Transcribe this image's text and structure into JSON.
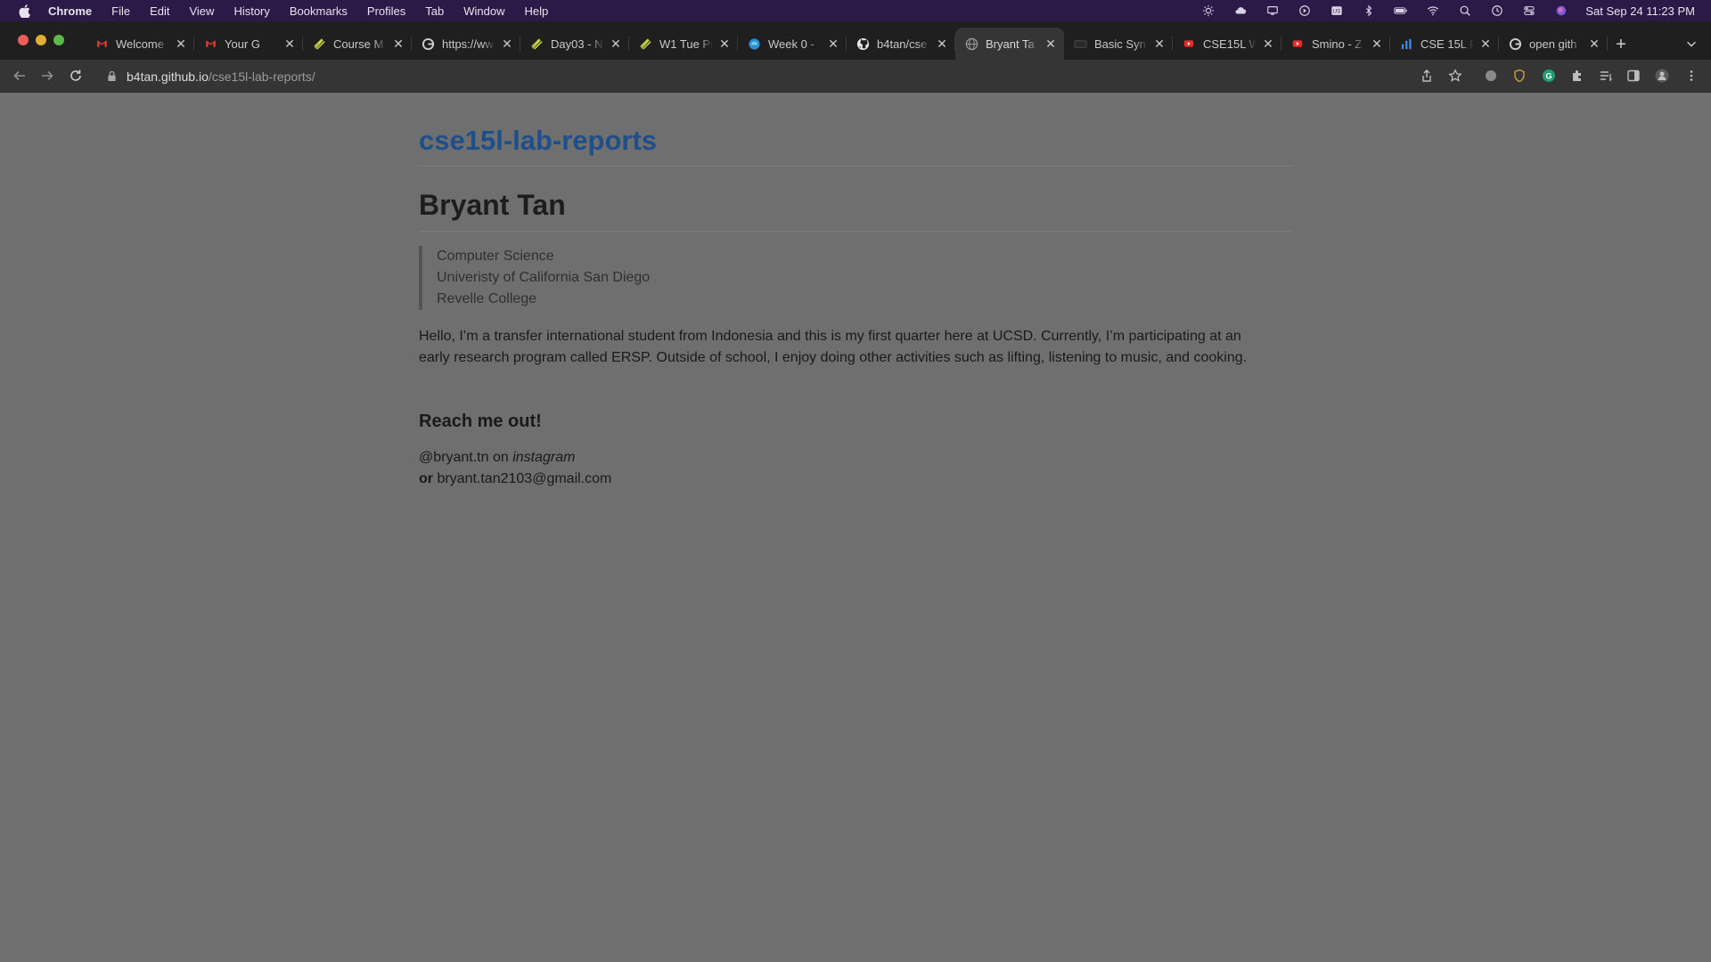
{
  "menubar": {
    "app": "Chrome",
    "items": [
      "File",
      "Edit",
      "View",
      "History",
      "Bookmarks",
      "Profiles",
      "Tab",
      "Window",
      "Help"
    ],
    "clock": "Sat Sep 24  11:23 PM"
  },
  "tabs": [
    {
      "title": "Welcome",
      "icon": "gmail-icon",
      "active": false
    },
    {
      "title": "Your G",
      "icon": "gmail-icon",
      "active": false
    },
    {
      "title": "Course M",
      "icon": "notebook-icon",
      "active": false
    },
    {
      "title": "https://ww",
      "icon": "google-icon",
      "active": false
    },
    {
      "title": "Day03 - N",
      "icon": "notebook-icon",
      "active": false
    },
    {
      "title": "W1 Tue Pr",
      "icon": "notebook-icon",
      "active": false
    },
    {
      "title": "Week 0 -",
      "icon": "edge-icon",
      "active": false
    },
    {
      "title": "b4tan/cse",
      "icon": "github-icon",
      "active": false
    },
    {
      "title": "Bryant Ta",
      "icon": "globe-icon",
      "active": true
    },
    {
      "title": "Basic Syn",
      "icon": "doc-icon",
      "active": false
    },
    {
      "title": "CSE15L W",
      "icon": "youtube-icon",
      "active": false
    },
    {
      "title": "Smino - Z",
      "icon": "youtube-icon",
      "active": false
    },
    {
      "title": "CSE 15L F",
      "icon": "chart-icon",
      "active": false
    },
    {
      "title": "open gith",
      "icon": "google-icon",
      "active": false
    }
  ],
  "address_bar": {
    "host": "b4tan.github.io",
    "path": "/cse15l-lab-reports/"
  },
  "page": {
    "site_title": "cse15l-lab-reports",
    "name": "Bryant Tan",
    "quote_lines": [
      "Computer Science",
      "Univeristy of California San Diego",
      "Revelle College"
    ],
    "bio": "Hello, I’m a transfer international student from Indonesia and this is my first quarter here at UCSD. Currently, I’m participating at an early research program called ERSP. Outside of school, I enjoy doing other activities such as lifting, listening to music, and cooking.",
    "reach_heading": "Reach me out!",
    "contact_handle": "@bryant.tn",
    "contact_on": " on ",
    "contact_platform": "instagram",
    "contact_or": "or",
    "contact_email": " bryant.tan2103@gmail.com"
  },
  "colors": {
    "menubar_bg": "#2b1a47",
    "tabstrip_bg": "#1f1f1f",
    "toolbar_bg": "#353535",
    "page_bg": "#6f6f6f",
    "link": "#1f4f8a"
  }
}
